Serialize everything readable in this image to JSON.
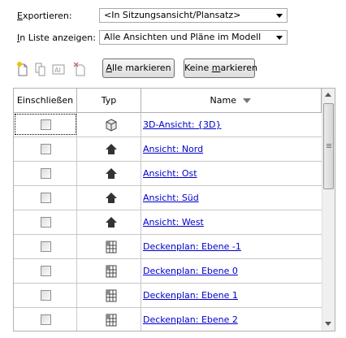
{
  "export": {
    "label": "Exportieren:",
    "value": "<In Sitzungsansicht/Plansatz>"
  },
  "list_show": {
    "label": "In Liste anzeigen:",
    "value": "Alle Ansichten und Pläne im Modell"
  },
  "toolbar": {
    "icons": [
      "new-set-icon",
      "duplicate-set-icon",
      "rename-set-icon",
      "delete-set-icon"
    ]
  },
  "buttons": {
    "select_all_u": "A",
    "select_all_rest": "lle markieren",
    "select_none_pre": "Keine ",
    "select_none_u": "m",
    "select_none_rest": "arkieren"
  },
  "table": {
    "columns": {
      "include": "Einschließen",
      "type": "Typ",
      "name": "Name"
    },
    "sort_icon": "sort-descending-icon",
    "rows": [
      {
        "checked": false,
        "type": "3d-view-icon",
        "name": "3D-Ansicht: {3D}"
      },
      {
        "checked": false,
        "type": "elevation-icon",
        "name": "Ansicht: Nord"
      },
      {
        "checked": false,
        "type": "elevation-icon",
        "name": "Ansicht: Ost"
      },
      {
        "checked": false,
        "type": "elevation-icon",
        "name": "Ansicht: Süd"
      },
      {
        "checked": false,
        "type": "elevation-icon",
        "name": "Ansicht: West"
      },
      {
        "checked": false,
        "type": "ceiling-plan-icon",
        "name": "Deckenplan: Ebene -1"
      },
      {
        "checked": false,
        "type": "ceiling-plan-icon",
        "name": "Deckenplan: Ebene 0"
      },
      {
        "checked": false,
        "type": "ceiling-plan-icon",
        "name": "Deckenplan: Ebene 1"
      },
      {
        "checked": false,
        "type": "ceiling-plan-icon",
        "name": "Deckenplan: Ebene 2"
      }
    ]
  }
}
